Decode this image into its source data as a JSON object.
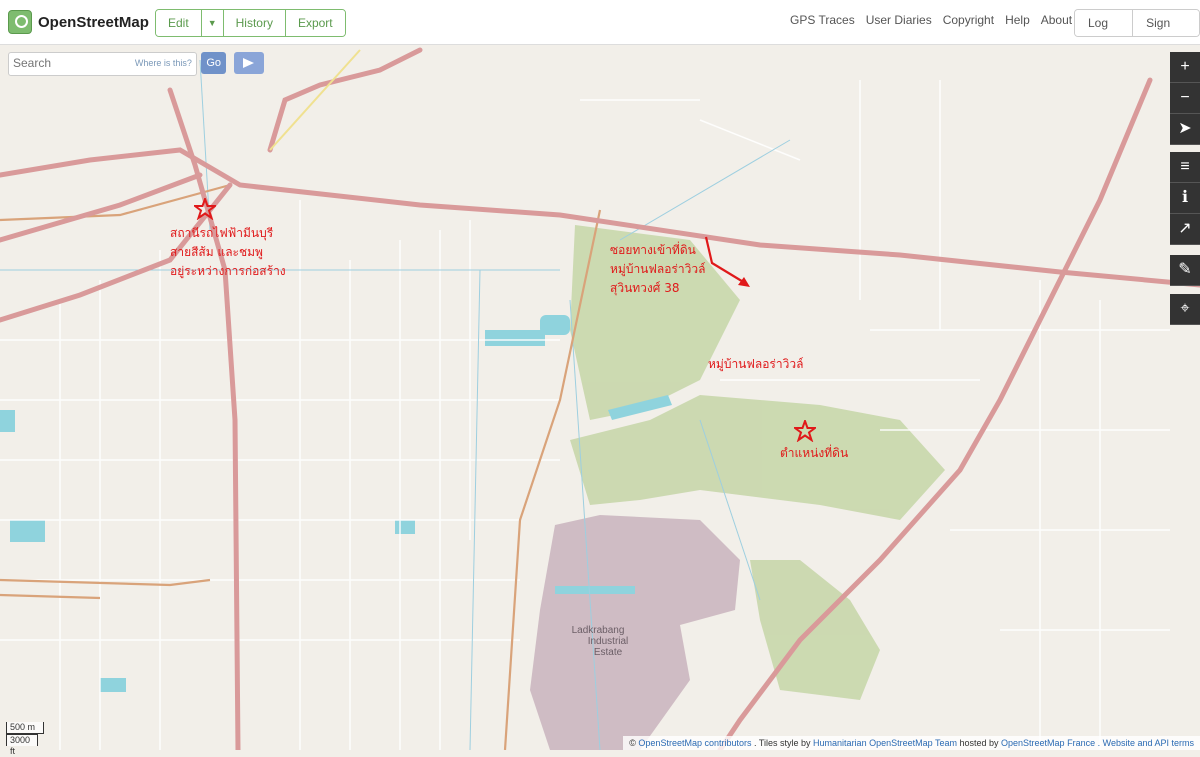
{
  "header": {
    "logo_text": "OpenStreetMap",
    "edit_label": "Edit",
    "history_label": "History",
    "export_label": "Export",
    "nav_links": [
      "GPS Traces",
      "User Diaries",
      "Copyright",
      "Help",
      "About"
    ],
    "login_label": "Log In",
    "signup_label": "Sign Up"
  },
  "search": {
    "placeholder": "Search",
    "where_label": "Where is this?",
    "go_label": "Go"
  },
  "controls": [
    "zoom-in",
    "zoom-out",
    "locate",
    "layers",
    "info",
    "share",
    "note",
    "query"
  ],
  "scale": {
    "metric": "500 m",
    "imperial": "3000 ft"
  },
  "attribution": {
    "prefix": "©",
    "osm_link": "OpenStreetMap contributors",
    "tiles_text": ". Tiles style by",
    "hot_link": "Humanitarian OpenStreetMap Team",
    "hosted_text": "hosted by",
    "france_link": "OpenStreetMap France",
    "terms_link": ". Website and API terms"
  },
  "annotations": {
    "station": [
      "สถานีรถไฟฟ้ามีนบุรี",
      "สายสีส้ม และชมพู",
      "อยู่ระหว่างการก่อสร้าง"
    ],
    "entrance": [
      "ซอยทางเข้าที่ดิน",
      "หมู่บ้านฟลอร่าวิวล์",
      "สุวินทวงศ์ 38"
    ],
    "village": "หมู่บ้านฟลอร่าวิวล์",
    "land": "ตำแหน่งที่ดิน"
  },
  "map_labels": {
    "estate": [
      "Ladkrabang",
      "Industrial",
      "Estate"
    ]
  },
  "colors": {
    "osm_green": "#7ebc6f",
    "annotation_red": "#e0191a",
    "road_primary": "#d99a9a",
    "park_green": "#c8d7ab",
    "industrial": "#c9b3bd",
    "water": "#8fd3dd"
  }
}
